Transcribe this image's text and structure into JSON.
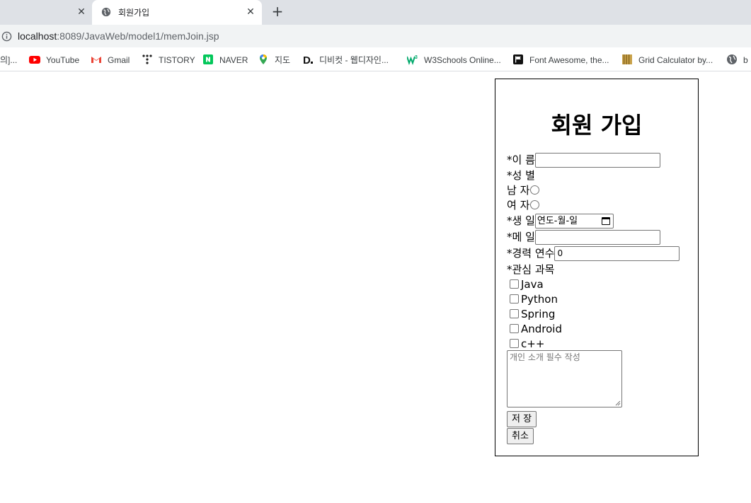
{
  "browser": {
    "prev_tab_close": "✕",
    "active_tab": {
      "title": "회원가입",
      "close": "✕"
    },
    "new_tab": "+",
    "address": {
      "host": "localhost",
      "path": ":8089/JavaWeb/model1/memJoin.jsp"
    },
    "bookmarks": [
      {
        "label": "의]...",
        "icon": "none"
      },
      {
        "label": "YouTube",
        "icon": "youtube-icon"
      },
      {
        "label": "Gmail",
        "icon": "gmail-icon"
      },
      {
        "label": "TISTORY",
        "icon": "tistory-icon"
      },
      {
        "label": "NAVER",
        "icon": "naver-icon"
      },
      {
        "label": "지도",
        "icon": "maps-icon"
      },
      {
        "label": "디비컷 - 웹디자인...",
        "icon": "dbcut-icon"
      },
      {
        "label": "W3Schools Online...",
        "icon": "w3schools-icon"
      },
      {
        "label": "Font Awesome, the...",
        "icon": "fontawesome-icon"
      },
      {
        "label": "Grid Calculator by...",
        "icon": "grid-calculator-icon"
      },
      {
        "label": "b",
        "icon": "globe-icon"
      }
    ]
  },
  "form": {
    "title": "회원 가입",
    "name_label": "*이 름",
    "name_value": "",
    "gender_label": "*성 별",
    "male_label": "남 자",
    "female_label": "여 자",
    "birth_label": "*생 일",
    "birth_placeholder": "연도-월-일",
    "email_label": "*메 일",
    "email_value": "",
    "career_label": "*경력 연수",
    "career_value": "0",
    "interest_label": "*관심 과목",
    "interests": [
      "Java",
      "Python",
      "Spring",
      "Android",
      "c++"
    ],
    "intro_placeholder": "개인 소개 필수 작성",
    "save_button": "저 장",
    "cancel_button": "취소"
  },
  "colors": {
    "tabstrip": "#dee1e6",
    "addressbar": "#f1f3f4",
    "youtube": "#ff0000",
    "naver": "#03c75a",
    "w3schools": "#04aa6d"
  }
}
